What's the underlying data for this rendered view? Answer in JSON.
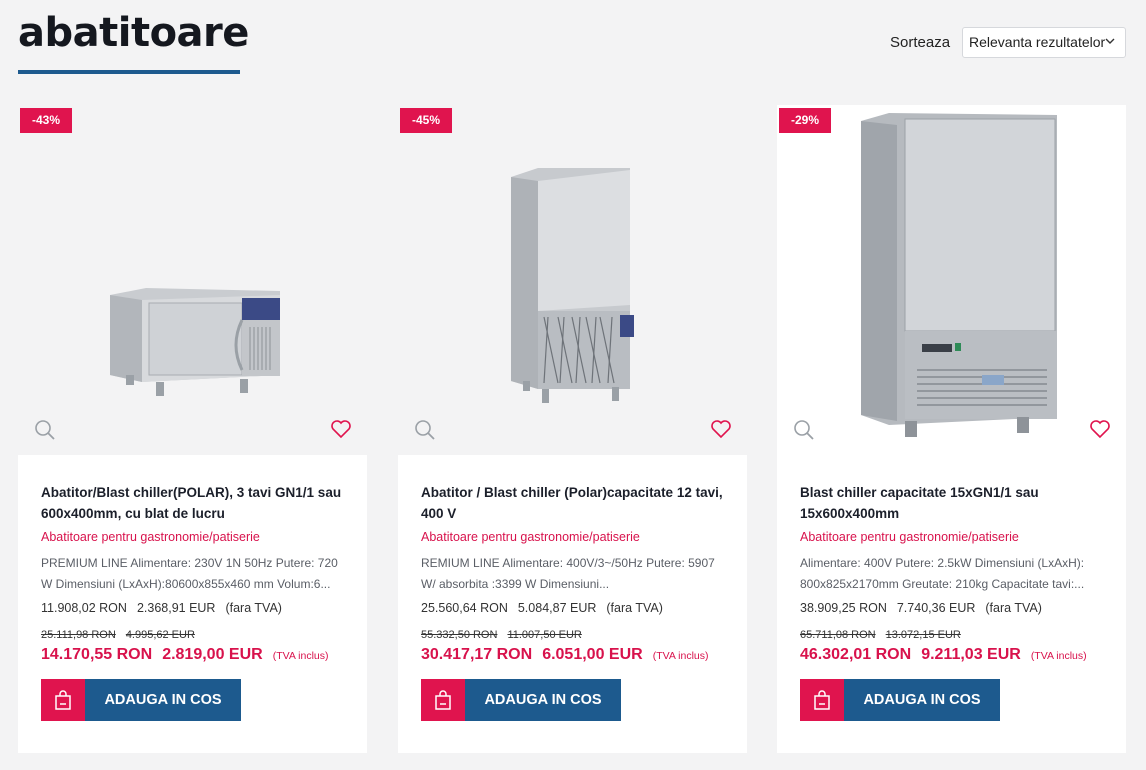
{
  "header": {
    "title": "abatitoare",
    "sort_label": "Sorteaza",
    "sort_value": "Relevanta rezultatelor"
  },
  "colors": {
    "accent_blue": "#1d5a8e",
    "accent_pink": "#e0144e"
  },
  "products": [
    {
      "badge": "-43%",
      "title": "Abatitor/Blast chiller(POLAR), 3 tavi GN1/1 sau 600x400mm, cu blat de lucru",
      "category": "Abatitoare pentru gastronomie/patiserie",
      "description": "PREMIUM LINE Alimentare: 230V 1N 50Hz Putere: 720 W Dimensiuni (LxAxH):80600x855x460 mm Volum:6...",
      "net_ron": "11.908,02 RON",
      "net_eur": "2.368,91 EUR",
      "net_note": "(fara TVA)",
      "old_ron": "25.111,98 RON",
      "old_eur": "4.995,62 EUR",
      "price_ron": "14.170,55 RON",
      "price_eur": "2.819,00 EUR",
      "vat_note": "(TVA inclus)",
      "cart_label": "ADAUGA IN COS"
    },
    {
      "badge": "-45%",
      "title": "Abatitor / Blast chiller (Polar)capacitate 12 tavi, 400 V",
      "category": "Abatitoare pentru gastronomie/patiserie",
      "description": "REMIUM LINE Alimentare: 400V/3~/50Hz Putere: 5907 W/ absorbita :3399 W Dimensiuni...",
      "net_ron": "25.560,64 RON",
      "net_eur": "5.084,87 EUR",
      "net_note": "(fara TVA)",
      "old_ron": "55.332,50 RON",
      "old_eur": "11.007,50 EUR",
      "price_ron": "30.417,17 RON",
      "price_eur": "6.051,00 EUR",
      "vat_note": "(TVA inclus)",
      "cart_label": "ADAUGA IN COS"
    },
    {
      "badge": "-29%",
      "title": "Blast chiller capacitate 15xGN1/1 sau 15x600x400mm",
      "category": "Abatitoare pentru gastronomie/patiserie",
      "description": "Alimentare: 400V Putere: 2.5kW Dimensiuni (LxAxH): 800x825x2170mm Greutate: 210kg Capacitate tavi:...",
      "net_ron": "38.909,25 RON",
      "net_eur": "7.740,36 EUR",
      "net_note": "(fara TVA)",
      "old_ron": "65.711,08 RON",
      "old_eur": "13.072,15 EUR",
      "price_ron": "46.302,01 RON",
      "price_eur": "9.211,03 EUR",
      "vat_note": "(TVA inclus)",
      "cart_label": "ADAUGA IN COS"
    }
  ]
}
